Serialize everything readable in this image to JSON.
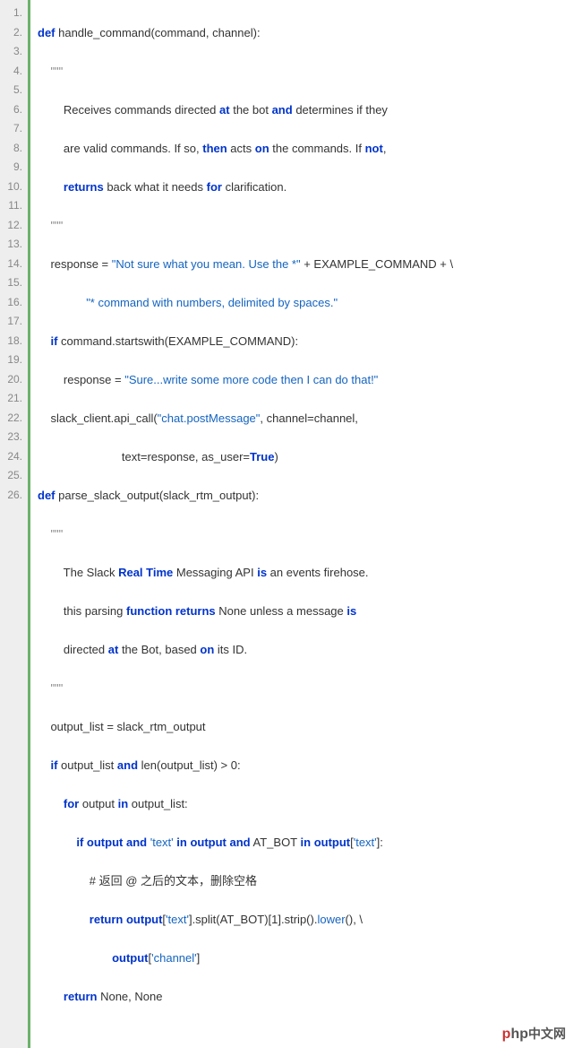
{
  "line_count": 26,
  "code": {
    "l1": {
      "kw1": "def",
      "name": " handle_command(command, channel):"
    },
    "l2": {
      "doc": "    \"\"\""
    },
    "l3": {
      "pre": "        Receives commands directed ",
      "kw": "at",
      "mid": " the bot ",
      "kw2": "and",
      "post": " determines if they"
    },
    "l4": {
      "pre": "        are valid commands. If so, ",
      "kw": "then",
      "mid": " acts ",
      "kw2": "on",
      "post": " the commands. If ",
      "kw3": "not",
      "end": ","
    },
    "l5": {
      "pre": "        ",
      "kw": "returns",
      "mid": " back what it needs ",
      "kw2": "for",
      "post": " clarification."
    },
    "l6": {
      "doc": "    \"\"\""
    },
    "l7": {
      "pre": "    response = ",
      "str": "\"Not sure what you mean. Use the *\"",
      "mid": " + EXAMPLE_COMMAND + \\"
    },
    "l8": {
      "pre": "               ",
      "str": "\"* command with numbers, delimited by spaces.\""
    },
    "l9": {
      "pre": "    ",
      "kw": "if",
      "post": " command.startswith(EXAMPLE_COMMAND):"
    },
    "l10": {
      "pre": "        response = ",
      "str": "\"Sure...write some more code then I can do that!\""
    },
    "l11": {
      "pre": "    slack_client.api_call(",
      "str": "\"chat.postMessage\"",
      "post": ", channel=channel,"
    },
    "l12": {
      "pre": "                          text=response, as_user=",
      "kw": "True",
      "post": ")"
    },
    "l13": {
      "kw1": "def",
      "name": " parse_slack_output(slack_rtm_output):"
    },
    "l14": {
      "doc": "    \"\"\""
    },
    "l15": {
      "pre": "        The Slack ",
      "kw": "Real Time",
      "mid": " Messaging API ",
      "kw2": "is",
      "post": " an events firehose."
    },
    "l16": {
      "pre": "        this parsing ",
      "kw": "function returns",
      "mid": " None unless a message ",
      "kw2": "is"
    },
    "l17": {
      "pre": "        directed ",
      "kw": "at",
      "mid": " the Bot, based ",
      "kw2": "on",
      "post": " its ID."
    },
    "l18": {
      "doc": "    \"\"\""
    },
    "l19": {
      "text": "    output_list = slack_rtm_output"
    },
    "l20": {
      "pre": "    ",
      "kw": "if",
      "mid": " output_list ",
      "kw2": "and",
      "post": " len(output_list) > 0:"
    },
    "l21": {
      "pre": "        ",
      "kw": "for",
      "mid": " output ",
      "kw2": "in",
      "post": " output_list:"
    },
    "l22": {
      "pre": "            ",
      "kw": "if",
      "mid": " ",
      "kw2": "output",
      "mid2": " ",
      "kw3": "and",
      "mid3": " ",
      "str": "'text'",
      "mid4": " ",
      "kw4": "in",
      "mid5": " ",
      "kw5": "output",
      "mid6": " ",
      "kw6": "and",
      "mid7": " AT_BOT ",
      "kw7": "in",
      "mid8": " ",
      "kw8": "output",
      "post": "[",
      "str2": "'text'",
      "end": "]:"
    },
    "l23": {
      "text": "                # 返回 @ 之后的文本，删除空格"
    },
    "l24": {
      "pre": "                ",
      "kw": "return",
      "mid": " ",
      "kw2": "output",
      "post": "[",
      "str": "'text'",
      "mid2": "].split(AT_BOT)[1].strip().",
      "fn": "lower",
      "end": "(), \\"
    },
    "l25": {
      "pre": "                       ",
      "kw": "output",
      "post": "[",
      "str": "'channel'",
      "end": "]"
    },
    "l26": {
      "pre": "        ",
      "kw": "return",
      "post": " None, None"
    }
  },
  "watermark": {
    "p": "p",
    "hp": "hp",
    "cn": "中文网"
  }
}
